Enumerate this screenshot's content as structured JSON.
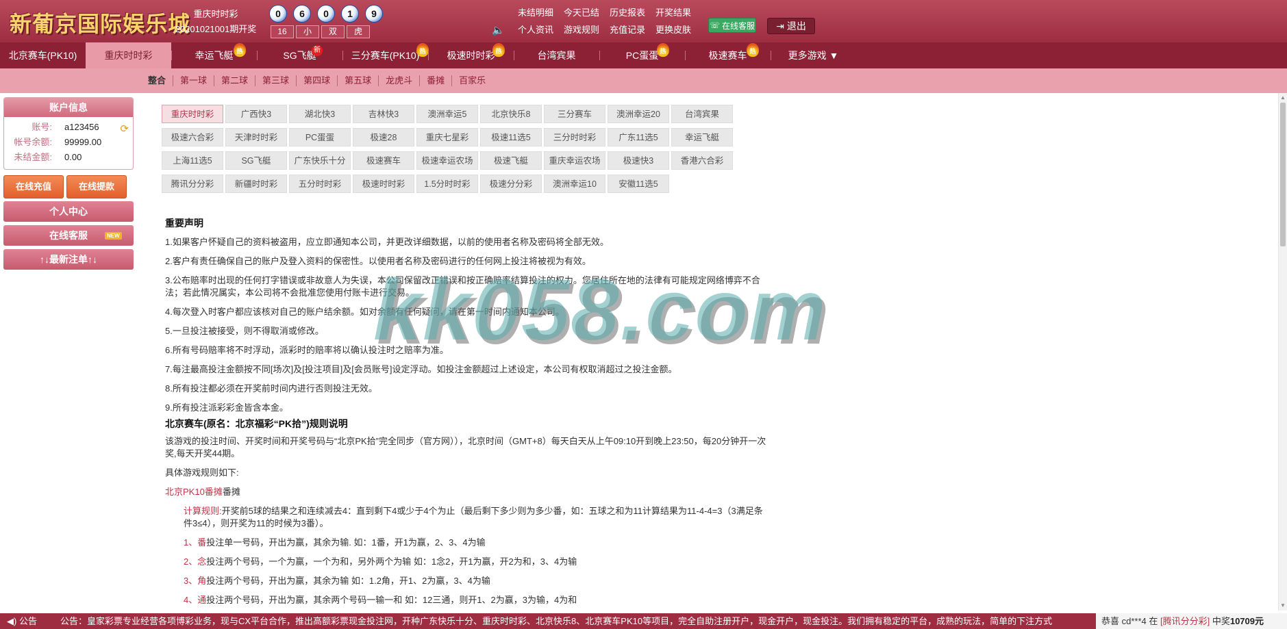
{
  "header": {
    "logo": "新葡京国际娱乐城",
    "game_name": "重庆时时彩",
    "period": "20201021001期开奖",
    "balls": [
      "0",
      "6",
      "0",
      "1",
      "9"
    ],
    "result_tags": [
      "16",
      "小",
      "双",
      "虎"
    ],
    "links": [
      "未结明细",
      "今天已结",
      "历史报表",
      "开奖结果",
      "个人资讯",
      "游戏规则",
      "充值记录",
      "更换皮肤"
    ],
    "service_label": "在线客服",
    "logout_label": "退出"
  },
  "game_nav": [
    {
      "label": "北京赛车(PK10)",
      "badge": ""
    },
    {
      "label": "重庆时时彩",
      "badge": "",
      "active": true
    },
    {
      "label": "幸运飞艇",
      "badge": "热"
    },
    {
      "label": "SG飞艇",
      "badge": "新"
    },
    {
      "label": "三分赛车(PK10)",
      "badge": "热"
    },
    {
      "label": "极速时时彩",
      "badge": "热"
    },
    {
      "label": "台湾宾果",
      "badge": ""
    },
    {
      "label": "PC蛋蛋",
      "badge": "热"
    },
    {
      "label": "极速赛车",
      "badge": "热"
    },
    {
      "label": "更多游戏 ▼",
      "badge": ""
    }
  ],
  "sub_nav": [
    "整合",
    "第一球",
    "第二球",
    "第三球",
    "第四球",
    "第五球",
    "龙虎斗",
    "番摊",
    "百家乐"
  ],
  "account": {
    "title": "账户信息",
    "rows": [
      {
        "key": "账号:",
        "value": "a123456"
      },
      {
        "key": "帐号余额:",
        "value": "99999.00"
      },
      {
        "key": "未结金额:",
        "value": "0.00"
      }
    ],
    "recharge": "在线充值",
    "withdraw": "在线提款",
    "personal_center": "个人中心",
    "online_service": "在线客服",
    "new_tag": "NEW",
    "latest_bets": "↑↓最新注单↑↓"
  },
  "lotteries": [
    "重庆时时彩",
    "广西快3",
    "湖北快3",
    "吉林快3",
    "澳洲幸运5",
    "北京快乐8",
    "三分赛车",
    "澳洲幸运20",
    "台湾宾果",
    "极速六合彩",
    "天津时时彩",
    "PC蛋蛋",
    "极速28",
    "重庆七星彩",
    "极速11选5",
    "三分时时彩",
    "广东11选5",
    "幸运飞艇",
    "上海11选5",
    "SG飞艇",
    "广东快乐十分",
    "极速赛车",
    "极速幸运农场",
    "极速飞艇",
    "重庆幸运农场",
    "极速快3",
    "香港六合彩",
    "腾讯分分彩",
    "新疆时时彩",
    "五分时时彩",
    "极速时时彩",
    "1.5分时时彩",
    "极速分分彩",
    "澳洲幸运10",
    "安徽11选5"
  ],
  "notice": {
    "title": "重要声明",
    "items": [
      "1.如果客户怀疑自己的资料被盗用，应立即通知本公司，并更改详细数据，以前的使用者名称及密码将全部无效。",
      "2.客户有责任确保自己的账户及登入资料的保密性。以使用者名称及密码进行的任何网上投注将被视为有效。",
      "3.公布赔率时出现的任何打字错误或非故意人为失误，本公司保留改正错误和按正确赔率结算投注的权力。您居住所在地的法律有可能规定网络博弈不合法；若此情况属实，本公司将不会批准您使用付账卡进行交易。",
      "4.每次登入时客户都应该核对自己的账户结余额。如对余额有任何疑问，请在第一时间内通知本公司。",
      "5.一旦投注被接受，则不得取消或修改。",
      "6.所有号码赔率将不时浮动，派彩时的赔率将以确认投注时之赔率为准。",
      "7.每注最高投注金额按不同[场次]及[投注项目]及[会员账号]设定浮动。如投注金额超过上述设定，本公司有权取消超过之投注金额。",
      "8.所有投注都必须在开奖前时间内进行否则投注无效。",
      "9.所有投注派彩彩金皆含本金。"
    ]
  },
  "rules": {
    "title": "北京赛车(原名：北京福彩“PK拾”)规则说明",
    "intro": "该游戏的投注时间、开奖时间和开奖号码与“北京PK拾”完全同步（官方网）），北京时间（GMT+8）每天白天从上午09:10开到晚上23:50，每20分钟开一次奖,每天开奖44期。",
    "detail_label": "具体游戏规则如下:",
    "section_red": "北京PK10番摊",
    "section_black": "番摊",
    "calc_label": "计算规则:",
    "calc_text": "开奖前5球的结果之和连续减去4：直到剩下4或少于4个为止（最后剩下多少则为多少番，如：五球之和为11计算结果为11-4-4=3（3满足条件3≤4），则开奖为11的时候为3番）。",
    "items": [
      {
        "num": "1、",
        "name": "番",
        "text": "投注单一号码，开出为赢，其余为输. 如：1番，开1为赢，2、3、4为输"
      },
      {
        "num": "2、",
        "name": "念",
        "text": "投注两个号码，一个为赢，一个为和，另外两个为输 如：1念2，开1为赢，开2为和，3、4为输"
      },
      {
        "num": "3、",
        "name": "角",
        "text": "投注两个号码，开出为赢，其余为输 如：1.2角，开1、2为赢，3、4为输"
      },
      {
        "num": "4、",
        "name": "通",
        "text": "投注两个号码，开出为赢，其余两个号码一输一和 如：12三通，则开1、2为赢，3为输，4为和"
      }
    ]
  },
  "watermark": "kk058.com",
  "bottom": {
    "label": "◀) 公告",
    "ticker": "公告：皇家彩票专业经营各项博彩业务，现与CX平台合作，推出高额彩票现金投注网，开种广东快乐十分、重庆时时彩、北京快乐8、北京赛车PK10等项目，完全自助注册开户，现金开户，现金投注。我们拥有稳定的平台，成熟的玩法，简单的下注方式",
    "winner_prefix": "恭喜 cd***4 在 ",
    "winner_game": "[腾讯分分彩]",
    "winner_mid": " 中奖",
    "winner_amount": "10709元"
  }
}
